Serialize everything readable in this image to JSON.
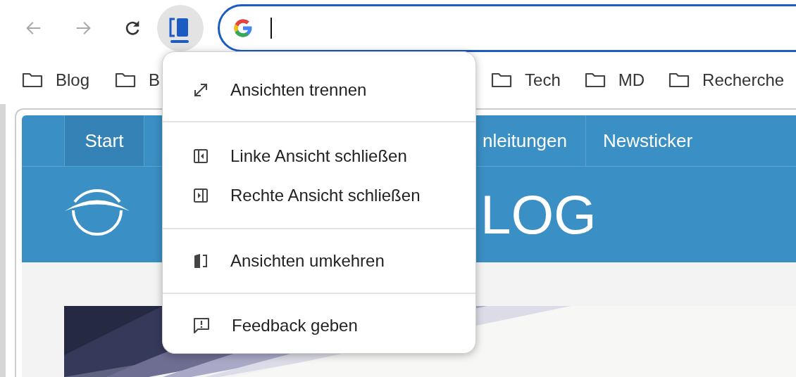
{
  "toolbar": {
    "back": {
      "disabled": true
    },
    "forward": {
      "disabled": true
    },
    "split_view_button": {
      "active": true
    },
    "address_bar": {
      "focused": true
    }
  },
  "bookmarks": {
    "left": [
      {
        "label": "Blog"
      },
      {
        "label": "B"
      }
    ],
    "right": [
      {
        "label": "Tech"
      },
      {
        "label": "MD"
      },
      {
        "label": "Recherche"
      }
    ]
  },
  "site": {
    "nav": [
      {
        "label": "Start",
        "selected": true
      },
      {
        "label": "nleitungen",
        "selected": false
      },
      {
        "label": "Newsticker",
        "selected": false
      }
    ],
    "logo_text": "LOG"
  },
  "menu": {
    "sections": [
      [
        {
          "kind": "expand",
          "label": "Ansichten trennen"
        }
      ],
      [
        {
          "kind": "close-left",
          "label": "Linke Ansicht schließen"
        },
        {
          "kind": "close-right",
          "label": "Rechte Ansicht schließen"
        }
      ],
      [
        {
          "kind": "swap",
          "label": "Ansichten umkehren"
        }
      ],
      [
        {
          "kind": "feedback",
          "label": "Feedback geben"
        }
      ]
    ]
  }
}
